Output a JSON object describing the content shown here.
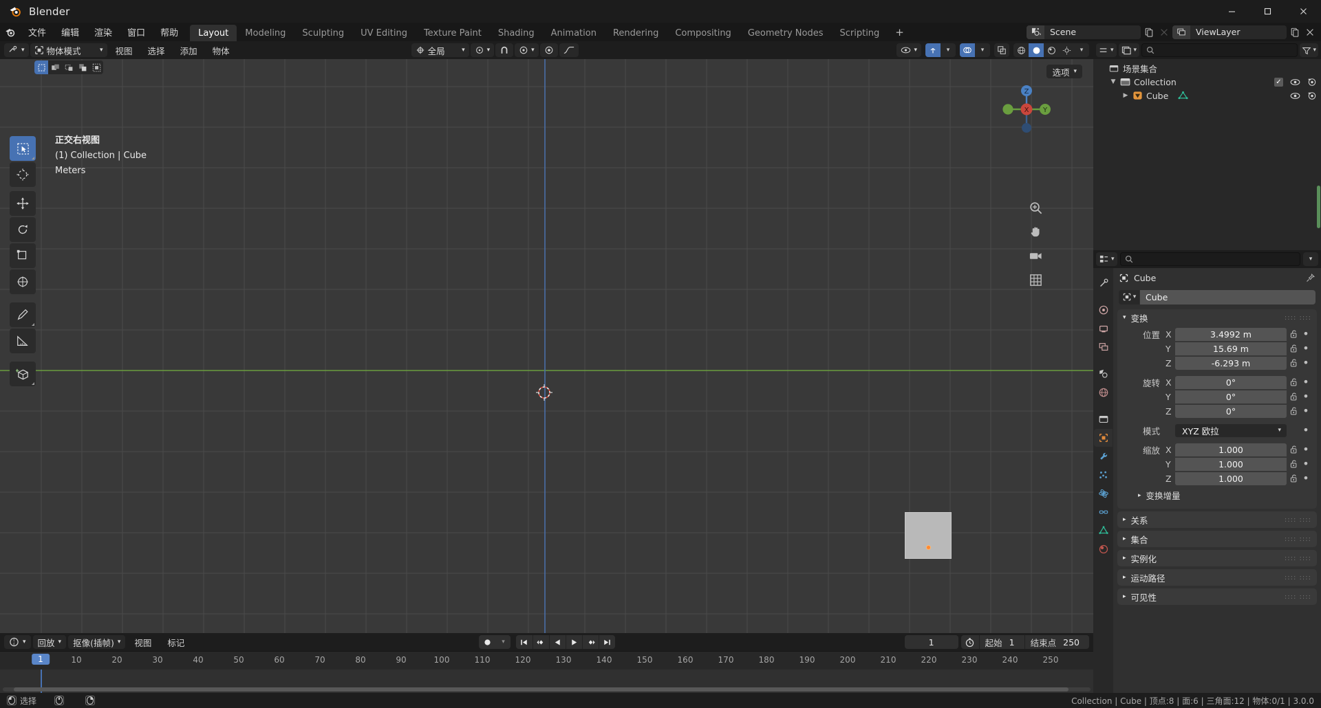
{
  "window": {
    "title": "Blender",
    "logo_icon": "blender-logo-icon",
    "minimize_label": "─",
    "maximize_label": "❐",
    "close_label": "✕"
  },
  "topbar": {
    "app_icon": "blender-icon",
    "menus": [
      "文件",
      "编辑",
      "渲染",
      "窗口",
      "帮助"
    ],
    "workspaces": [
      {
        "label": "Layout",
        "active": true
      },
      {
        "label": "Modeling",
        "active": false
      },
      {
        "label": "Sculpting",
        "active": false
      },
      {
        "label": "UV Editing",
        "active": false
      },
      {
        "label": "Texture Paint",
        "active": false
      },
      {
        "label": "Shading",
        "active": false
      },
      {
        "label": "Animation",
        "active": false
      },
      {
        "label": "Rendering",
        "active": false
      },
      {
        "label": "Compositing",
        "active": false
      },
      {
        "label": "Geometry Nodes",
        "active": false
      },
      {
        "label": "Scripting",
        "active": false
      }
    ],
    "add_workspace_label": "+",
    "scene": {
      "icon": "scene-icon",
      "name": "Scene",
      "new_icon": "new-scene-icon",
      "unlink_icon": "unlink-icon"
    },
    "view_layer": {
      "icon": "view-layer-icon",
      "name": "ViewLayer",
      "new_icon": "new-layer-icon",
      "remove_icon": "remove-layer-icon"
    }
  },
  "viewport": {
    "header": {
      "editor_type_icon": "editor-type-3dview-icon",
      "mode": "物体模式",
      "mode_icon": "object-mode-icon",
      "menus": [
        "视图",
        "选择",
        "添加",
        "物体"
      ],
      "transform_orientation": "全局",
      "transform_orientation_icon": "orientation-icon",
      "snap_icon": "snap-magnet-icon",
      "snap_target_icon": "snap-target-icon",
      "proportional_icon": "proportional-edit-icon",
      "proportional_falloff_icon": "falloff-curve-icon",
      "visibility_icon": "visibility-dropdown-icon",
      "gizmo_icon": "gizmo-icon",
      "overlays_icon": "overlays-icon",
      "xray_icon": "xray-toggle-icon",
      "shading_modes": [
        "wireframe-shading-icon",
        "solid-shading-icon",
        "material-preview-icon",
        "rendered-shading-icon"
      ],
      "active_shading_index": 1
    },
    "select_modes": [
      "select-box-icon",
      "select-extend-icon",
      "select-subtract-icon",
      "select-invert-icon",
      "select-intersect-icon"
    ],
    "active_select_mode": 0,
    "options_label": "选项",
    "overlay_text": {
      "line1": "正交右视图",
      "line2": "(1) Collection | Cube",
      "line3": "Meters"
    },
    "tools": [
      {
        "name": "tool-tweak",
        "icon": "cursor-select-icon",
        "active": true
      },
      {
        "name": "tool-cursor",
        "icon": "3d-cursor-icon",
        "active": false
      },
      {
        "name": "tool-move",
        "icon": "move-icon",
        "active": false
      },
      {
        "name": "tool-rotate",
        "icon": "rotate-icon",
        "active": false
      },
      {
        "name": "tool-scale",
        "icon": "scale-icon",
        "active": false
      },
      {
        "name": "tool-transform",
        "icon": "transform-icon",
        "active": false
      },
      {
        "name": "tool-annotate",
        "icon": "annotate-pen-icon",
        "active": false
      },
      {
        "name": "tool-measure",
        "icon": "measure-ruler-icon",
        "active": false
      },
      {
        "name": "tool-add-cube",
        "icon": "add-cube-icon",
        "active": false
      }
    ],
    "gizmo_axes": {
      "x": "X",
      "y": "Y",
      "z": "Z"
    },
    "nav_buttons": [
      "zoom-icon",
      "pan-hand-icon",
      "camera-view-icon",
      "ortho-persp-toggle-icon"
    ]
  },
  "timeline": {
    "editor_icon": "timeline-editor-icon",
    "menus": [
      {
        "label": "回放",
        "dropdown": true
      },
      {
        "label": "抠像(插帧)",
        "dropdown": true
      },
      {
        "label": "视图",
        "dropdown": false
      },
      {
        "label": "标记",
        "dropdown": false
      }
    ],
    "record_icon": "auto-keying-record-icon",
    "playback_buttons": [
      "jump-to-start-icon",
      "jump-to-prev-keyframe-icon",
      "play-reverse-icon",
      "play-icon",
      "jump-to-next-keyframe-icon",
      "jump-to-end-icon"
    ],
    "current_frame": "1",
    "start_icon": "frame-range-clock-icon",
    "start_label": "起始",
    "start_value": "1",
    "end_label": "结束点",
    "end_value": "250",
    "ruler_ticks": [
      "10",
      "20",
      "30",
      "40",
      "50",
      "60",
      "70",
      "80",
      "90",
      "100",
      "110",
      "120",
      "130",
      "140",
      "150",
      "160",
      "170",
      "180",
      "190",
      "200",
      "210",
      "220",
      "230",
      "240",
      "250"
    ],
    "playhead_label": "1"
  },
  "outliner": {
    "display_mode_icon": "outliner-display-mode-icon",
    "filter_id_icon": "outliner-id-type-icon",
    "search_icon": "search-icon",
    "search_placeholder": "",
    "search_value": "",
    "filter_icon": "filter-funnel-icon",
    "rows": [
      {
        "name": "场景集合",
        "icon": "scene-collection-icon",
        "depth": 0,
        "disclosure": "none",
        "has_checkbox": false,
        "has_eye": false,
        "has_camera": false
      },
      {
        "name": "Collection",
        "icon": "collection-icon",
        "depth": 1,
        "disclosure": "open",
        "has_checkbox": true,
        "has_eye": true,
        "has_camera": true
      },
      {
        "name": "Cube",
        "icon": "mesh-object-icon",
        "data_icon": "mesh-data-icon",
        "depth": 2,
        "disclosure": "closed",
        "has_checkbox": false,
        "has_eye": true,
        "has_camera": true
      }
    ]
  },
  "properties": {
    "editor_icon": "properties-editor-icon",
    "search_icon": "search-icon",
    "search_value": "",
    "search_placeholder": "",
    "options_icon": "chevron-down-icon",
    "tabs": [
      {
        "name": "tool-tab",
        "icon": "tool-properties-icon",
        "active": false
      },
      {
        "name": "render-tab",
        "icon": "render-properties-icon",
        "active": false
      },
      {
        "name": "output-tab",
        "icon": "output-properties-icon",
        "active": false
      },
      {
        "name": "view-layer-tab",
        "icon": "view-layer-properties-icon",
        "active": false
      },
      {
        "name": "scene-tab",
        "icon": "scene-properties-icon",
        "active": false
      },
      {
        "name": "world-tab",
        "icon": "world-properties-icon",
        "active": false
      },
      {
        "name": "collection-tab",
        "icon": "collection-properties-icon",
        "active": false
      },
      {
        "name": "object-tab",
        "icon": "object-properties-icon",
        "active": true
      },
      {
        "name": "modifier-tab",
        "icon": "modifier-wrench-icon",
        "active": false
      },
      {
        "name": "particles-tab",
        "icon": "particles-properties-icon",
        "active": false
      },
      {
        "name": "physics-tab",
        "icon": "physics-properties-icon",
        "active": false
      },
      {
        "name": "constraints-tab",
        "icon": "object-constraints-icon",
        "active": false
      },
      {
        "name": "data-tab",
        "icon": "object-data-icon",
        "active": false
      },
      {
        "name": "material-tab",
        "icon": "material-properties-icon",
        "active": false
      }
    ],
    "breadcrumb": {
      "icon": "object-properties-icon",
      "label": "Cube",
      "pin_icon": "pin-icon"
    },
    "name_field": {
      "icon": "object-properties-icon",
      "value": "Cube"
    },
    "transform_panel": {
      "title": "变换",
      "expanded": true,
      "grip_icon": "drag-grip-icon",
      "location_label": "位置",
      "rotation_label": "旋转",
      "scale_label": "缩放",
      "axes": [
        "X",
        "Y",
        "Z"
      ],
      "location": [
        "3.4992 m",
        "15.69 m",
        "-6.293 m"
      ],
      "rotation": [
        "0°",
        "0°",
        "0°"
      ],
      "rotation_mode_label": "模式",
      "rotation_mode_value": "XYZ 欧拉",
      "scale": [
        "1.000",
        "1.000",
        "1.000"
      ],
      "lock_icon": "unlocked-padlock-icon",
      "animate_icon": "animate-dot-icon",
      "delta_subpanel": "变换增量"
    },
    "collapsed_panels": [
      {
        "label": "关系",
        "grip_icon": "drag-grip-icon"
      },
      {
        "label": "集合",
        "grip_icon": "drag-grip-icon"
      },
      {
        "label": "实例化",
        "grip_icon": "drag-grip-icon"
      },
      {
        "label": "运动路径",
        "grip_icon": "drag-grip-icon"
      },
      {
        "label": "可见性",
        "grip_icon": "drag-grip-icon"
      }
    ]
  },
  "statusbar": {
    "hints": [
      {
        "key": "mouse-left-icon",
        "label": "选择"
      },
      {
        "key": "mouse-middle-icon",
        "label": ""
      },
      {
        "key": "mouse-right-icon",
        "label": ""
      }
    ],
    "scene_stats": "Collection | Cube | 顶点:8 | 面:6 | 三角面:12 | 物体:0/1 | 3.0.0"
  },
  "colors": {
    "accent_blue": "#4772b3",
    "header_bg": "#1d1d1d",
    "panel_bg": "#303030",
    "viewport_bg": "#393939",
    "axis_green": "#6a9e3f",
    "axis_blue": "#4a6ea8",
    "cursor_red": "#dd4b3e",
    "origin_orange": "#ff8833"
  }
}
